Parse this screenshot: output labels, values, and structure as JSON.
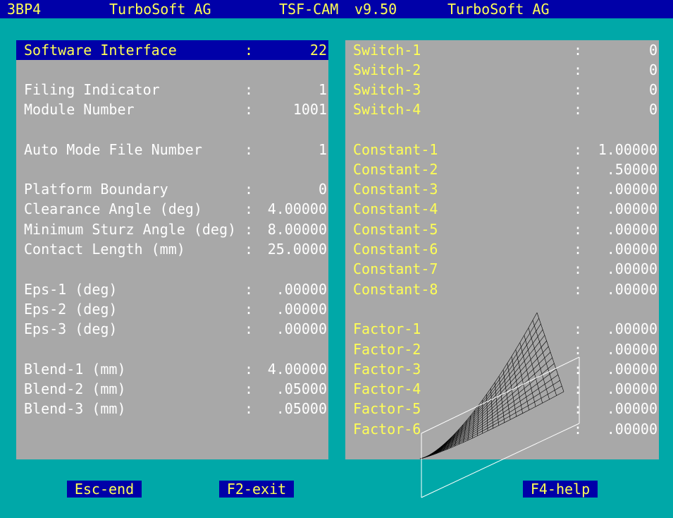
{
  "header": {
    "code": "3BP4",
    "company": "TurboSoft AG",
    "product": "TSF-CAM",
    "version": "v9.50",
    "company2": "TurboSoft AG"
  },
  "left_panel": {
    "rows": [
      {
        "label": "Software Interface",
        "value": "22"
      },
      {
        "label": "Filing Indicator",
        "value": "1"
      },
      {
        "label": "Module Number",
        "value": "1001"
      },
      {
        "label": "Auto Mode File Number",
        "value": "1"
      },
      {
        "label": "Platform Boundary",
        "value": "0"
      },
      {
        "label": "Clearance Angle (deg)",
        "value": "4.00000"
      },
      {
        "label": "Minimum Sturz Angle (deg)",
        "value": "8.00000"
      },
      {
        "label": "Contact Length (mm)",
        "value": "25.0000"
      },
      {
        "label": "Eps-1 (deg)",
        "value": ".00000"
      },
      {
        "label": "Eps-2 (deg)",
        "value": ".00000"
      },
      {
        "label": "Eps-3 (deg)",
        "value": ".00000"
      },
      {
        "label": "Blend-1 (mm)",
        "value": "4.00000"
      },
      {
        "label": "Blend-2 (mm)",
        "value": ".05000"
      },
      {
        "label": "Blend-3 (mm)",
        "value": ".05000"
      }
    ]
  },
  "right_panel": {
    "rows": [
      {
        "label": "Switch-1",
        "value": "0"
      },
      {
        "label": "Switch-2",
        "value": "0"
      },
      {
        "label": "Switch-3",
        "value": "0"
      },
      {
        "label": "Switch-4",
        "value": "0"
      },
      {
        "label": "Constant-1",
        "value": "1.00000"
      },
      {
        "label": "Constant-2",
        "value": ".50000"
      },
      {
        "label": "Constant-3",
        "value": ".00000"
      },
      {
        "label": "Constant-4",
        "value": ".00000"
      },
      {
        "label": "Constant-5",
        "value": ".00000"
      },
      {
        "label": "Constant-6",
        "value": ".00000"
      },
      {
        "label": "Constant-7",
        "value": ".00000"
      },
      {
        "label": "Constant-8",
        "value": ".00000"
      },
      {
        "label": "Factor-1",
        "value": ".00000"
      },
      {
        "label": "Factor-2",
        "value": ".00000"
      },
      {
        "label": "Factor-3",
        "value": ".00000"
      },
      {
        "label": "Factor-4",
        "value": ".00000"
      },
      {
        "label": "Factor-5",
        "value": ".00000"
      },
      {
        "label": "Factor-6",
        "value": ".00000"
      }
    ]
  },
  "separator": ":",
  "function_keys": {
    "esc": "Esc-end",
    "f2": "F2-exit",
    "f4": "F4-help"
  },
  "colors": {
    "background": "#00a8a8",
    "panel": "#a8a8a8",
    "highlight": "#0000a8",
    "highlight_text": "#ffff55",
    "text": "#ffffff"
  }
}
